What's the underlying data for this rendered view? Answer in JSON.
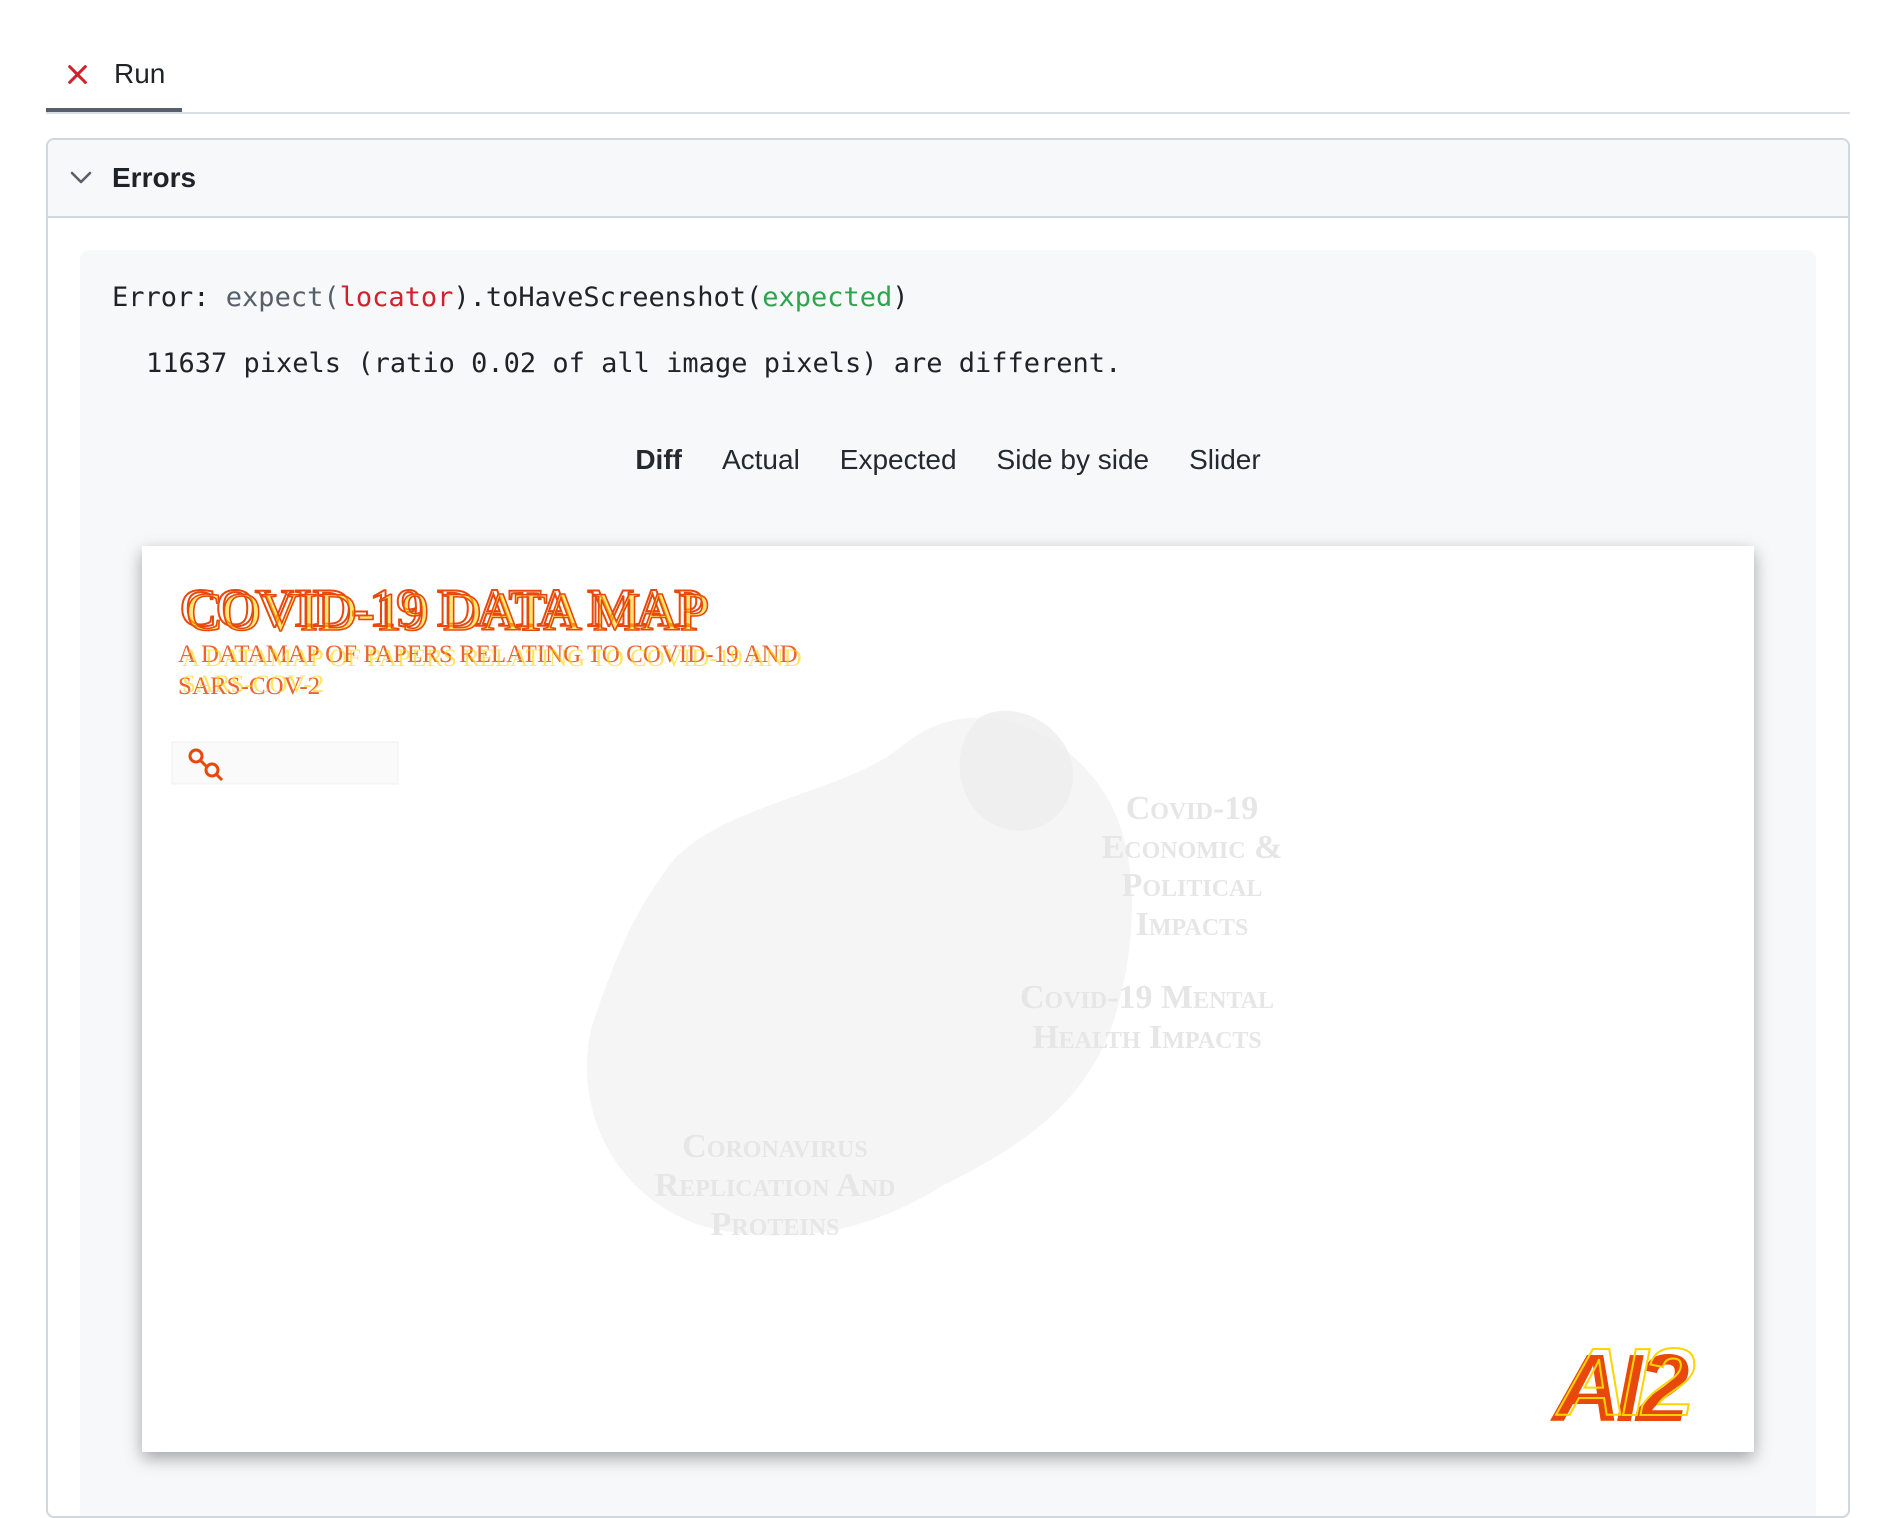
{
  "tabs": [
    {
      "label": "Run",
      "status_icon": "x-fail-icon",
      "status_color": "#cf222e"
    }
  ],
  "errors_section": {
    "title": "Errors",
    "expanded": true
  },
  "error": {
    "prefix": "Error: ",
    "call_expect": "expect(",
    "call_locator": "locator",
    "call_method": ").toHaveScreenshot(",
    "call_expected": "expected",
    "call_close": ")",
    "message": "11637 pixels (ratio 0.02 of all image pixels) are different."
  },
  "view_tabs": [
    {
      "label": "Diff",
      "active": true
    },
    {
      "label": "Actual",
      "active": false
    },
    {
      "label": "Expected",
      "active": false
    },
    {
      "label": "Side by side",
      "active": false
    },
    {
      "label": "Slider",
      "active": false
    }
  ],
  "diff_image": {
    "title": "COVID-19 DATA MAP",
    "subtitle_line1": "A DATAMAP OF PAPERS RELATING TO COVID-19 AND",
    "subtitle_line2": "SARS-COV-2",
    "clusters": [
      {
        "label_lines": [
          "Covid-19",
          "Economic &",
          "Political",
          "Impacts"
        ]
      },
      {
        "label_lines": [
          "Covid-19 Mental",
          "Health Impacts"
        ]
      },
      {
        "label_lines": [
          "Coronavirus",
          "Replication And",
          "Proteins"
        ]
      }
    ],
    "logo_text": "AI2",
    "diff_color": "#e8480c",
    "highlight_color": "#ffd400"
  }
}
